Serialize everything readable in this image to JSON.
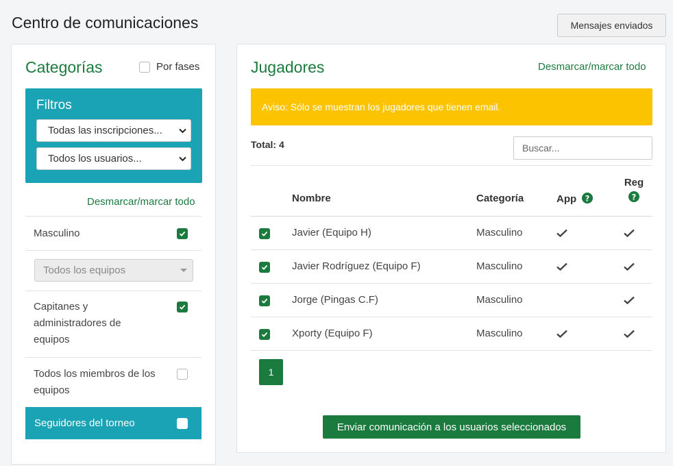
{
  "header": {
    "title": "Centro de comunicaciones",
    "sent_button": "Mensajes enviados"
  },
  "left": {
    "title": "Categorías",
    "by_phase_label": "Por fases",
    "by_phase_checked": false,
    "filters": {
      "title": "Filtros",
      "registration_select": "Todas las inscripciones...",
      "users_select": "Todos los usuarios..."
    },
    "toggle_all": "Desmarcar/marcar todo",
    "category": {
      "label": "Masculino",
      "checked": true
    },
    "team_select": "Todos los equipos",
    "captains": {
      "label": "Capitanes y administradores de equipos",
      "checked": true
    },
    "all_members": {
      "label": "Todos los miembros de los equipos",
      "checked": false
    },
    "followers": {
      "label": "Seguidores del torneo",
      "checked": false
    }
  },
  "right": {
    "title": "Jugadores",
    "toggle_all": "Desmarcar/marcar todo",
    "alert": "Aviso: Sólo se muestran los jugadores que tienen email.",
    "total": "Total: 4",
    "search_placeholder": "Buscar...",
    "columns": {
      "name": "Nombre",
      "category": "Categoría",
      "app": "App",
      "reg": "Reg"
    },
    "rows": [
      {
        "name": "Javier (Equipo H)",
        "category": "Masculino",
        "app": true,
        "reg": true,
        "checked": true
      },
      {
        "name": "Javier Rodríguez (Equipo F)",
        "category": "Masculino",
        "app": true,
        "reg": true,
        "checked": true
      },
      {
        "name": "Jorge (Pingas C.F)",
        "category": "Masculino",
        "app": false,
        "reg": true,
        "checked": true
      },
      {
        "name": "Xporty (Equipo F)",
        "category": "Masculino",
        "app": true,
        "reg": true,
        "checked": true
      }
    ],
    "page": "1",
    "send_button": "Enviar comunicación a los usuarios seleccionados"
  },
  "colors": {
    "accent_green": "#1b7a3e",
    "teal": "#1aa3b5",
    "warning": "#fbc300"
  }
}
